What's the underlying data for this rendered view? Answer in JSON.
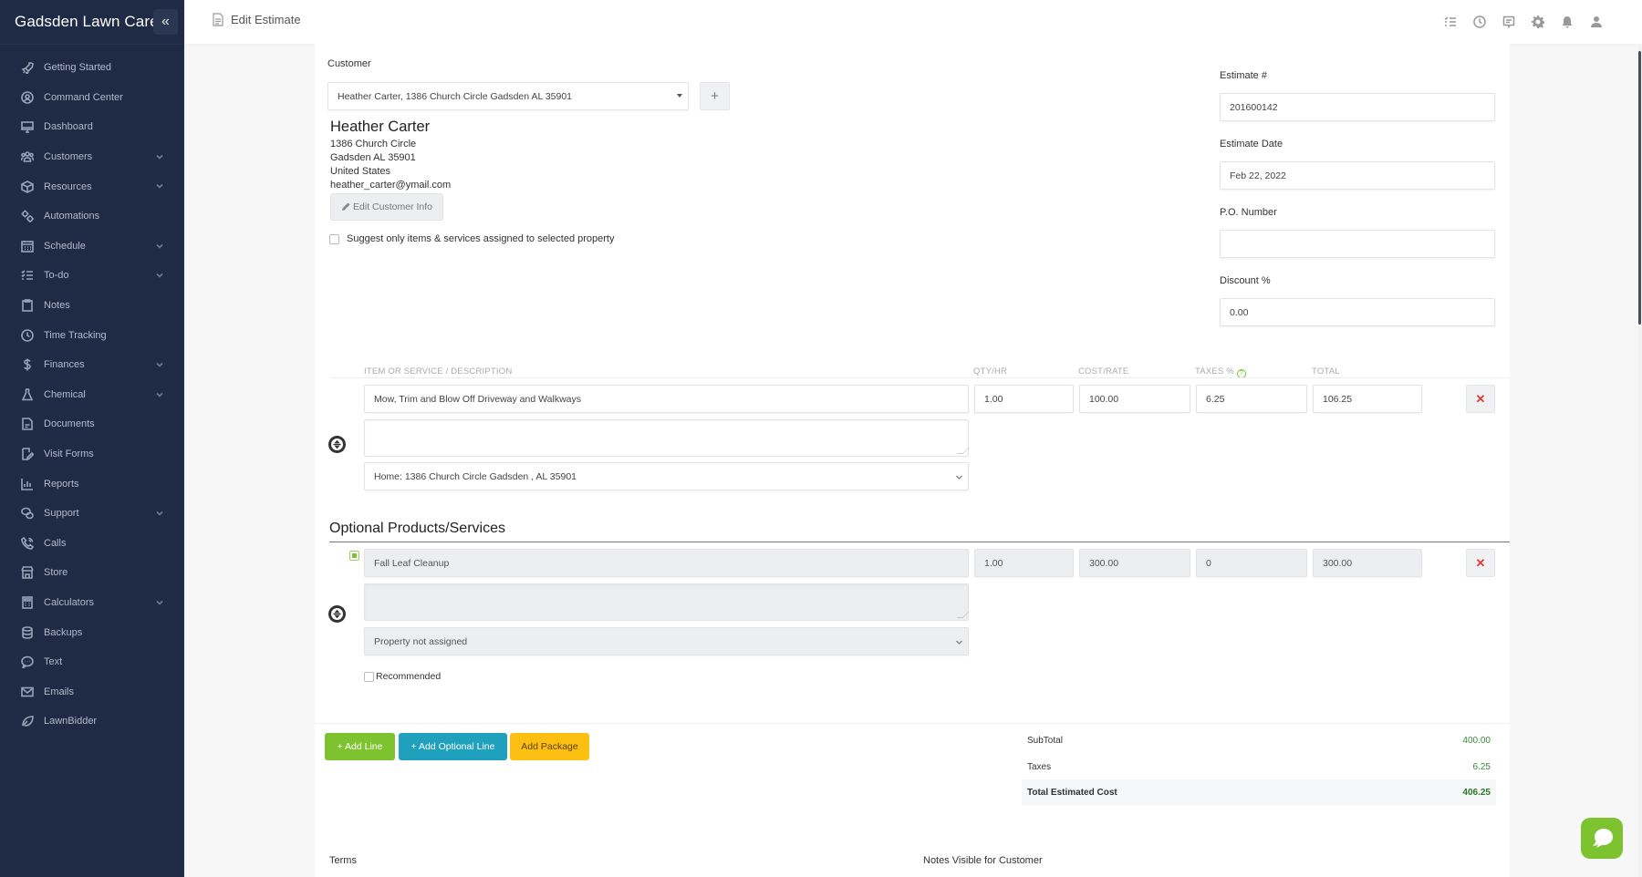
{
  "sidebar": {
    "brand": "Gadsden Lawn Care",
    "collapse_icon": "double-chevron-left-icon",
    "items": [
      {
        "label": "Getting Started",
        "icon": "rocket-icon",
        "has_submenu": false
      },
      {
        "label": "Command Center",
        "icon": "command-center-icon",
        "has_submenu": false
      },
      {
        "label": "Dashboard",
        "icon": "monitor-icon",
        "has_submenu": false
      },
      {
        "label": "Customers",
        "icon": "users-icon",
        "has_submenu": true
      },
      {
        "label": "Resources",
        "icon": "box-icon",
        "has_submenu": true
      },
      {
        "label": "Automations",
        "icon": "gears-icon",
        "has_submenu": false
      },
      {
        "label": "Schedule",
        "icon": "calendar-icon",
        "has_submenu": true
      },
      {
        "label": "To-do",
        "icon": "checklist-icon",
        "has_submenu": true
      },
      {
        "label": "Notes",
        "icon": "clipboard-icon",
        "has_submenu": false
      },
      {
        "label": "Time Tracking",
        "icon": "clock-icon",
        "has_submenu": false
      },
      {
        "label": "Finances",
        "icon": "dollar-icon",
        "has_submenu": true
      },
      {
        "label": "Chemical",
        "icon": "flask-icon",
        "has_submenu": true
      },
      {
        "label": "Documents",
        "icon": "document-icon",
        "has_submenu": false
      },
      {
        "label": "Visit Forms",
        "icon": "form-edit-icon",
        "has_submenu": false
      },
      {
        "label": "Reports",
        "icon": "bar-chart-icon",
        "has_submenu": false
      },
      {
        "label": "Support",
        "icon": "chat-bubbles-icon",
        "has_submenu": true
      },
      {
        "label": "Calls",
        "icon": "phone-icon",
        "has_submenu": false
      },
      {
        "label": "Store",
        "icon": "store-icon",
        "has_submenu": false
      },
      {
        "label": "Calculators",
        "icon": "calculator-icon",
        "has_submenu": true
      },
      {
        "label": "Backups",
        "icon": "database-icon",
        "has_submenu": false
      },
      {
        "label": "Text",
        "icon": "message-icon",
        "has_submenu": false
      },
      {
        "label": "Emails",
        "icon": "envelope-icon",
        "has_submenu": false
      },
      {
        "label": "LawnBidder",
        "icon": "leaf-icon",
        "has_submenu": false
      }
    ]
  },
  "header": {
    "title": "Edit Estimate",
    "icons": [
      "task-list-icon",
      "clock-icon",
      "comment-icon",
      "gear-icon",
      "bell-icon",
      "user-icon"
    ]
  },
  "customer": {
    "label": "Customer",
    "selected": "Heather Carter, 1386 Church Circle Gadsden AL 35901",
    "add_button": "+",
    "name": "Heather Carter",
    "address1": "1386 Church Circle",
    "address2": "Gadsden AL 35901",
    "country": "United States",
    "email": "heather_carter@ymail.com",
    "edit_button": "Edit Customer Info",
    "suggest_label": "Suggest only items & services assigned to selected property",
    "suggest_checked": false
  },
  "estimate": {
    "number_label": "Estimate #",
    "number": "201600142",
    "date_label": "Estimate Date",
    "date": "Feb 22, 2022",
    "po_label": "P.O. Number",
    "po": "",
    "discount_label": "Discount %",
    "discount": "0.00"
  },
  "table": {
    "headers": {
      "item": "ITEM OR SERVICE / DESCRIPTION",
      "qty": "QTY/HR",
      "cost": "COST/RATE",
      "taxes": "TAXES %",
      "total": "TOTAL"
    },
    "lines": [
      {
        "item": "Mow, Trim and Blow Off Driveway and Walkways",
        "description": "",
        "qty": "1.00",
        "cost": "100.00",
        "taxes": "6.25",
        "total": "106.25",
        "property": "Home: 1386 Church Circle Gadsden , AL 35901"
      }
    ]
  },
  "optional": {
    "title": "Optional Products/Services",
    "lines": [
      {
        "selected": true,
        "item": "Fall Leaf Cleanup",
        "description": "",
        "qty": "1.00",
        "cost": "300.00",
        "taxes": "0",
        "total": "300.00",
        "property": "Property not assigned",
        "recommended_label": "Recommended",
        "recommended": false
      }
    ]
  },
  "actions": {
    "add_line": "+ Add Line",
    "add_optional_line": "+ Add Optional Line",
    "add_package": "Add Package"
  },
  "totals": {
    "subtotal_label": "SubTotal",
    "subtotal": "400.00",
    "taxes_label": "Taxes",
    "taxes": "6.25",
    "total_label": "Total Estimated Cost",
    "total": "406.25"
  },
  "footer": {
    "terms_label": "Terms",
    "notes_label": "Notes Visible for Customer"
  },
  "colors": {
    "sidebar_bg": "#1f2a44",
    "accent_green": "#7dc32f",
    "accent_teal": "#1fa1bd",
    "accent_yellow": "#fdc012",
    "delete_red": "#e03a3a"
  }
}
